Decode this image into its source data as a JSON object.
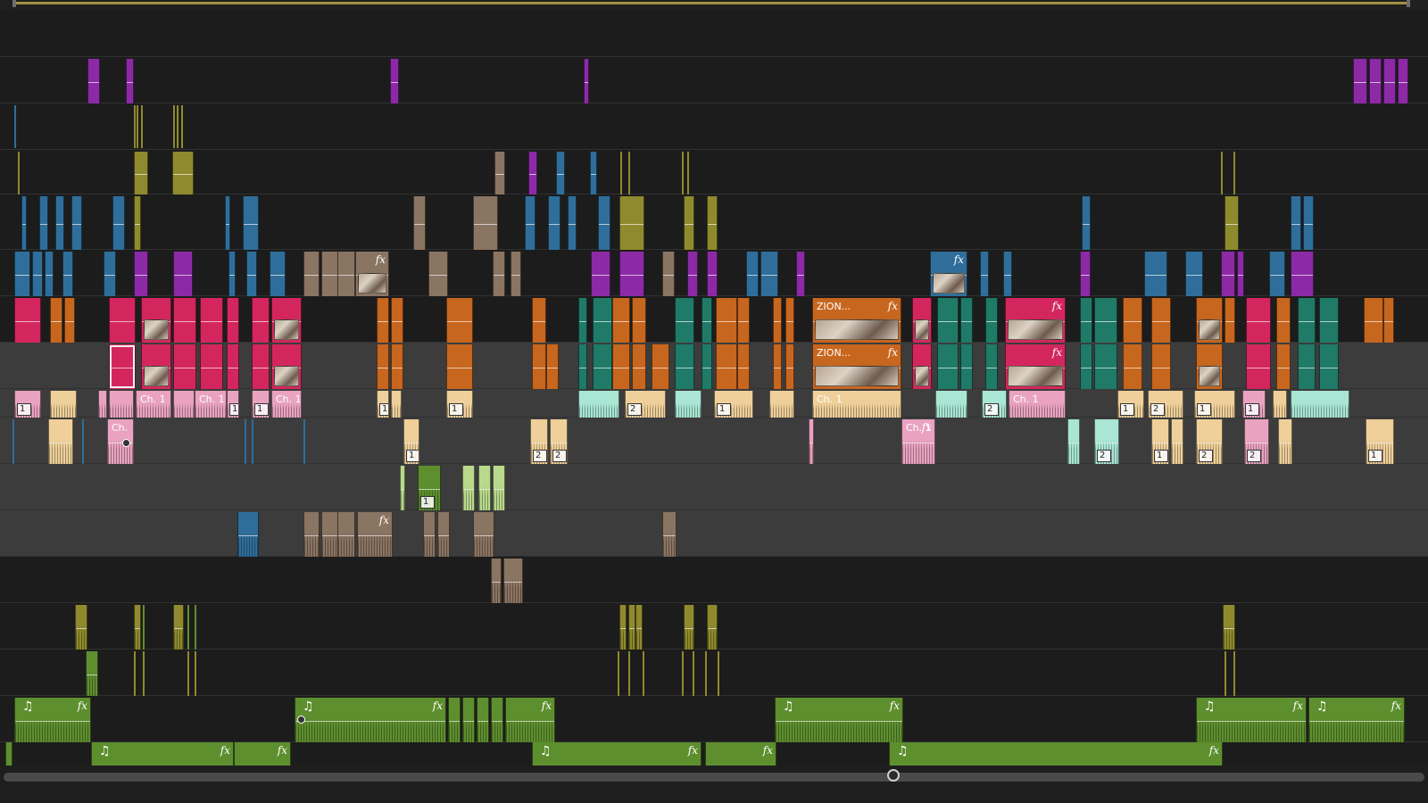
{
  "colors": {
    "purple": "#8c2aa6",
    "blue": "#2f6e9a",
    "olive": "#8f8a2d",
    "tan": "#8a7462",
    "magenta": "#d4265e",
    "orange": "#c7661e",
    "teal": "#1f7a68",
    "pink_audio": "#e9a3c0",
    "peach_audio": "#efd09a",
    "mint_audio": "#a9e6d4",
    "green_audio": "#5e8f2e",
    "light_green_audio": "#b9d98c"
  },
  "clips": {
    "zion_v2": {
      "label": "ZION...",
      "fx": "fx"
    },
    "zion_v1": {
      "label": "ZION...",
      "fx": "fx"
    },
    "ch1_a": {
      "label": "Ch. 1"
    },
    "ch1_b": {
      "label": "Ch. 1"
    },
    "ch1_c": {
      "label": "Ch. 1"
    },
    "ch1_d": {
      "label": "Ch. 1"
    },
    "ch1_e": {
      "label": "Ch. 1"
    },
    "ch1_f": {
      "label": "Ch. 1"
    },
    "ch_short": {
      "label": "Ch."
    }
  },
  "badges": {
    "one": "1",
    "two": "2"
  },
  "fx_label": "fx",
  "music_icon": "♫"
}
